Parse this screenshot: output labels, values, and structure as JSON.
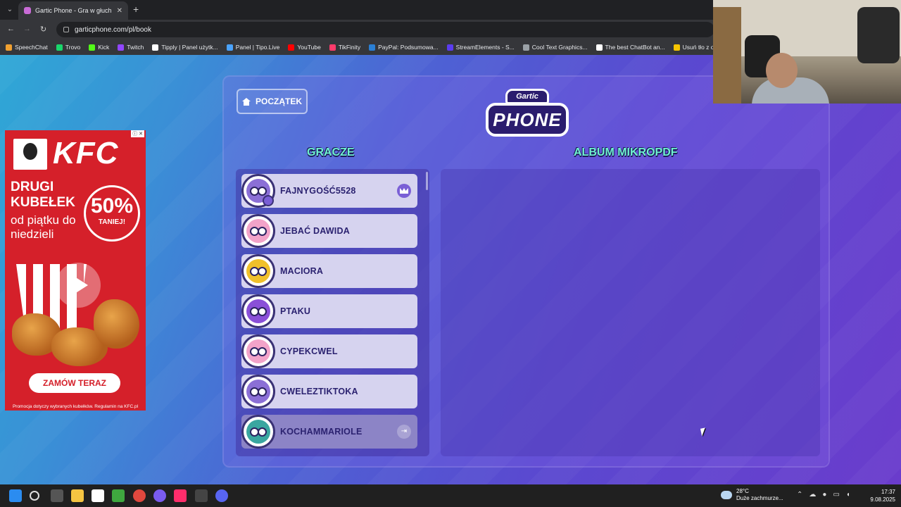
{
  "browser": {
    "tab_title": "Gartic Phone - Gra w głuch",
    "url": "garticphone.com/pl/book",
    "bookmarks": [
      {
        "label": "SpeechChat",
        "color": "#f0a030"
      },
      {
        "label": "Trovo",
        "color": "#19d66b"
      },
      {
        "label": "Kick",
        "color": "#53fc18"
      },
      {
        "label": "Twitch",
        "color": "#9146ff"
      },
      {
        "label": "Tipply | Panel użytk...",
        "color": "#ffffff"
      },
      {
        "label": "Panel | Tipo.Live",
        "color": "#4aa3ff"
      },
      {
        "label": "YouTube",
        "color": "#ff0000"
      },
      {
        "label": "TikFinity",
        "color": "#ff3b6b"
      },
      {
        "label": "PayPal: Podsumowa...",
        "color": "#2a7fd4"
      },
      {
        "label": "StreamElements - S...",
        "color": "#5b3cf0"
      },
      {
        "label": "Cool Text Graphics...",
        "color": "#9aa0a6"
      },
      {
        "label": "The best ChatBot an...",
        "color": "#ffffff"
      },
      {
        "label": "Usuń tło z obrazu -...",
        "color": "#f5c400"
      }
    ]
  },
  "ad": {
    "badge": "ⓘ ✕",
    "brand": "KFC",
    "headline": "DRUGI KUBEŁEK",
    "subline": "od piątku do niedzieli",
    "discount": "50%",
    "discount_sub": "TANIEJ!",
    "cta": "ZAMÓW TERAZ",
    "fine_print": "Promocja dotyczy wybranych kubełków. Regulamin na KFC.pl"
  },
  "game": {
    "home_label": "POCZĄTEK",
    "logo_top": "Gartic",
    "logo_bottom": "PHONE",
    "players_title": "GRACZE",
    "album_title": "ALBUM MIKROPDF",
    "players": [
      {
        "name": "FAJNYGOŚĆ5528",
        "color": "#8b6fd6",
        "host": true,
        "dim": false
      },
      {
        "name": "JEBAĆ DAWIDA",
        "color": "#f2a3c9",
        "host": false,
        "dim": false
      },
      {
        "name": "MACIORA",
        "color": "#f0c02a",
        "host": false,
        "dim": false
      },
      {
        "name": "PTAKU",
        "color": "#8a4fd8",
        "host": false,
        "dim": false
      },
      {
        "name": "CYPEKCWEL",
        "color": "#f2a3c9",
        "host": false,
        "dim": false
      },
      {
        "name": "CWELEZTIKTOKA",
        "color": "#8b6fd6",
        "host": false,
        "dim": false
      },
      {
        "name": "KOCHAMMARIOLE",
        "color": "#3aa6a0",
        "host": false,
        "dim": true
      }
    ]
  },
  "taskbar": {
    "temperature": "28°C",
    "weather": "Duże zachmurze...",
    "time": "17:37",
    "date": "9.08.2025"
  }
}
